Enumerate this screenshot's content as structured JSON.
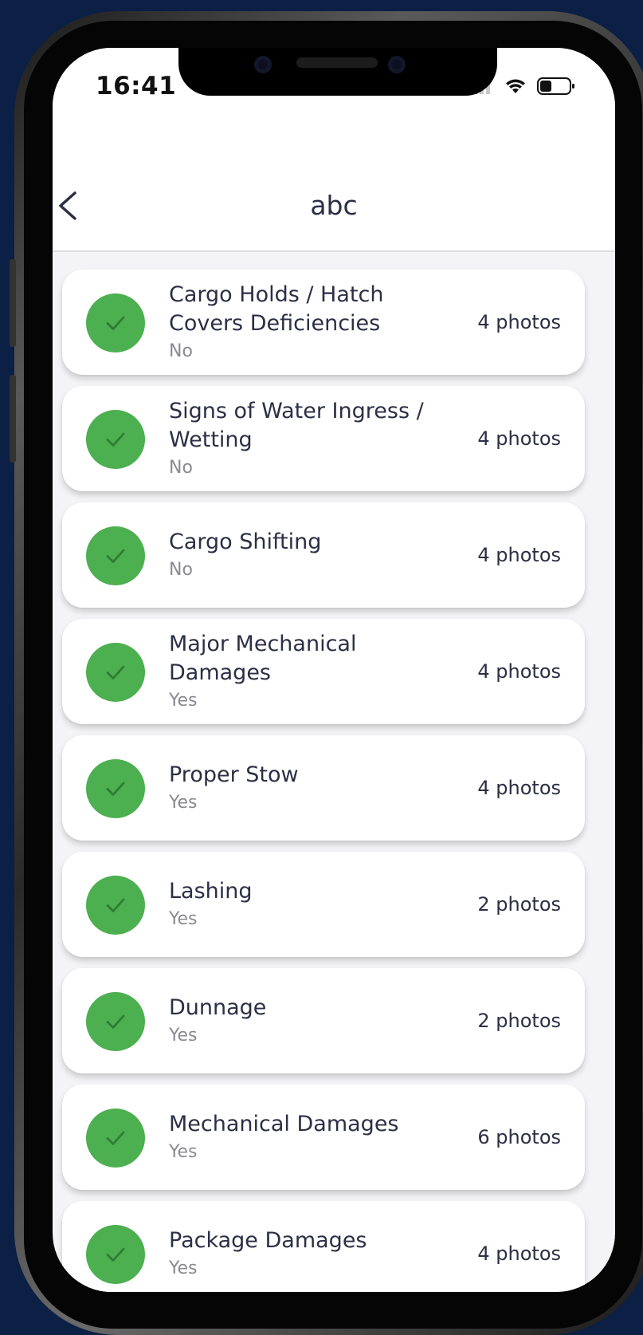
{
  "status_bar": {
    "time": "16:41"
  },
  "header": {
    "title": "abc"
  },
  "icons": {
    "back": "chevron-left-icon",
    "check": "checkmark-icon",
    "wifi": "wifi-icon",
    "battery": "battery-icon",
    "signal": "cellular-signal-icon"
  },
  "colors": {
    "check_green": "#4caf50",
    "text_dark": "#2c2f45",
    "text_muted": "#8a8a8f",
    "backdrop": "#0c1f45"
  },
  "items": [
    {
      "title": "Cargo Holds / Hatch Covers Deficiencies",
      "value": "No",
      "count": "4 photos"
    },
    {
      "title": "Signs of Water Ingress / Wetting",
      "value": "No",
      "count": "4 photos"
    },
    {
      "title": "Cargo Shifting",
      "value": "No",
      "count": "4 photos"
    },
    {
      "title": "Major Mechanical Damages",
      "value": "Yes",
      "count": "4 photos"
    },
    {
      "title": "Proper Stow",
      "value": "Yes",
      "count": "4 photos"
    },
    {
      "title": "Lashing",
      "value": "Yes",
      "count": "2 photos"
    },
    {
      "title": "Dunnage",
      "value": "Yes",
      "count": "2 photos"
    },
    {
      "title": "Mechanical Damages",
      "value": "Yes",
      "count": "6 photos"
    },
    {
      "title": "Package Damages",
      "value": "Yes",
      "count": "4 photos"
    }
  ]
}
